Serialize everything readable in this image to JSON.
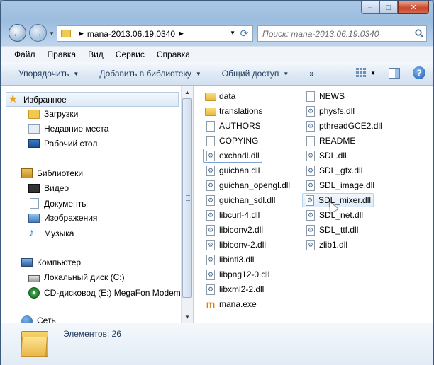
{
  "window": {
    "minimize": "‒",
    "maximize": "□",
    "close": "✕"
  },
  "address": {
    "path": "mana-2013.06.19.0340",
    "search_placeholder": "Поиск: mana-2013.06.19.0340"
  },
  "menu": [
    "Файл",
    "Правка",
    "Вид",
    "Сервис",
    "Справка"
  ],
  "toolbar": {
    "organize": "Упорядочить",
    "add_library": "Добавить в библиотеку",
    "share": "Общий доступ",
    "more": "»"
  },
  "nav": {
    "favorites": "Избранное",
    "downloads": "Загрузки",
    "recent": "Недавние места",
    "desktop": "Рабочий стол",
    "libraries": "Библиотеки",
    "video": "Видео",
    "documents": "Документы",
    "images": "Изображения",
    "music": "Музыка",
    "computer": "Компьютер",
    "local_disk": "Локальный диск (C:)",
    "cd_drive": "CD-дисковод (E:) MegaFon Modem",
    "network": "Сеть"
  },
  "files_col1": [
    {
      "name": "data",
      "type": "folder"
    },
    {
      "name": "translations",
      "type": "folder"
    },
    {
      "name": "AUTHORS",
      "type": "doc"
    },
    {
      "name": "COPYING",
      "type": "doc"
    },
    {
      "name": "exchndl.dll",
      "type": "dll"
    },
    {
      "name": "guichan.dll",
      "type": "dll"
    },
    {
      "name": "guichan_opengl.dll",
      "type": "dll"
    },
    {
      "name": "guichan_sdl.dll",
      "type": "dll"
    },
    {
      "name": "libcurl-4.dll",
      "type": "dll"
    },
    {
      "name": "libiconv2.dll",
      "type": "dll"
    },
    {
      "name": "libiconv-2.dll",
      "type": "dll"
    },
    {
      "name": "libintl3.dll",
      "type": "dll"
    },
    {
      "name": "libpng12-0.dll",
      "type": "dll"
    },
    {
      "name": "libxml2-2.dll",
      "type": "dll"
    },
    {
      "name": "mana.exe",
      "type": "exe"
    }
  ],
  "files_col2": [
    {
      "name": "NEWS",
      "type": "doc"
    },
    {
      "name": "physfs.dll",
      "type": "dll"
    },
    {
      "name": "pthreadGCE2.dll",
      "type": "dll"
    },
    {
      "name": "README",
      "type": "doc"
    },
    {
      "name": "SDL.dll",
      "type": "dll"
    },
    {
      "name": "SDL_gfx.dll",
      "type": "dll"
    },
    {
      "name": "SDL_image.dll",
      "type": "dll"
    },
    {
      "name": "SDL_mixer.dll",
      "type": "dll"
    },
    {
      "name": "SDL_net.dll",
      "type": "dll"
    },
    {
      "name": "SDL_ttf.dll",
      "type": "dll"
    },
    {
      "name": "zlib1.dll",
      "type": "dll"
    }
  ],
  "status": {
    "items_count": "Элементов: 26"
  }
}
